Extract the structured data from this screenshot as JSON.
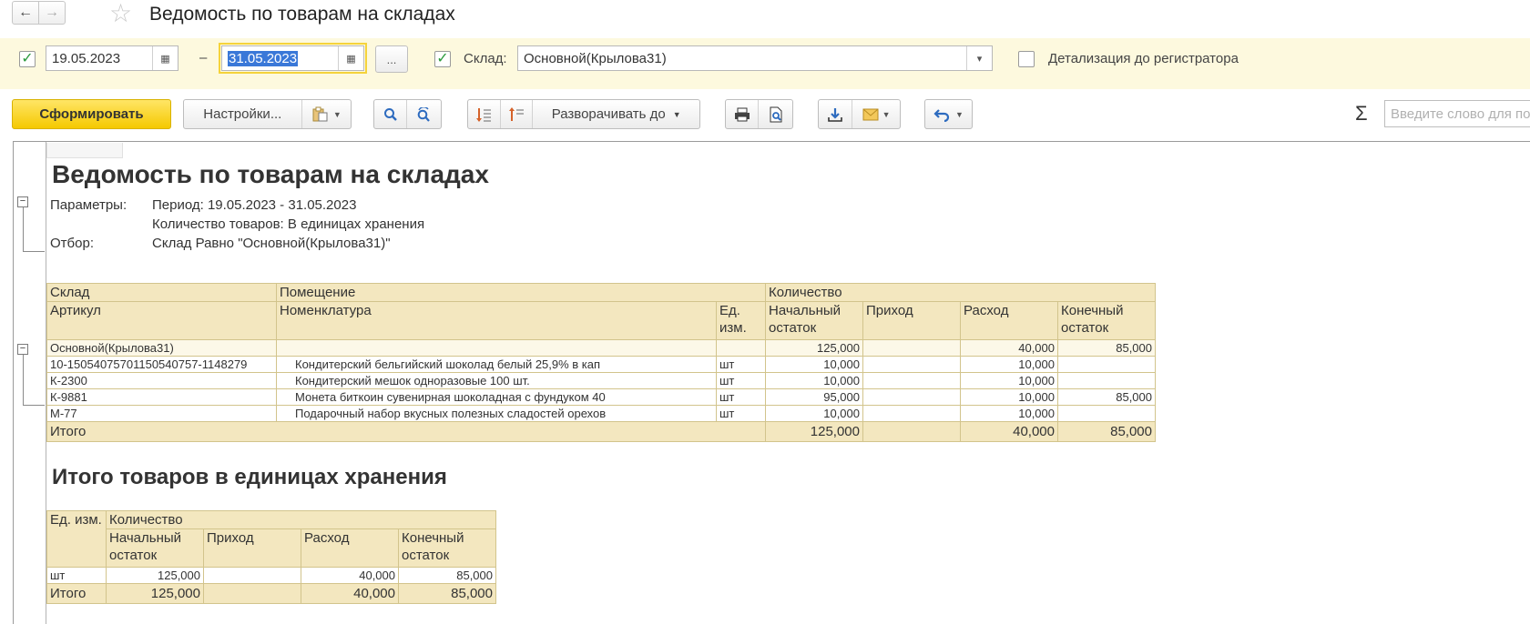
{
  "window": {
    "title": "Ведомость по товарам на складах",
    "back_icon": "←",
    "forward_icon": "→",
    "star_icon": "☆"
  },
  "filters": {
    "period_enabled": "✓",
    "date_from": "19.05.2023",
    "date_separator": "–",
    "date_to": "31.05.2023",
    "period_button": "...",
    "warehouse_enabled": "✓",
    "warehouse_label": "Склад:",
    "warehouse_value": "Основной(Крылова31)",
    "detail_label": "Детализация до регистратора",
    "calendar_icon": "▦",
    "dropdown_icon": "▾"
  },
  "toolbar": {
    "generate": "Сформировать",
    "settings": "Настройки...",
    "expand_to": "Разворачивать до",
    "sigma": "Σ",
    "search_placeholder": "Введите слово для поиска"
  },
  "report": {
    "title": "Ведомость по товарам на складах",
    "params_label": "Параметры:",
    "params_period": "Период: 19.05.2023 - 31.05.2023",
    "params_qty": "Количество товаров: В единицах хранения",
    "filter_label": "Отбор:",
    "filter_value": "Склад Равно \"Основной(Крылова31)\"",
    "main_table": {
      "h_sklad": "Склад",
      "h_pomeshchenie": "Помещение",
      "h_kolichestvo": "Количество",
      "h_artikul": "Артикул",
      "h_nomenklatura": "Номенклатура",
      "h_ed": "Ед. изм.",
      "h_nach": "Начальный остаток",
      "h_prihod": "Приход",
      "h_rashod": "Расход",
      "h_kon": "Конечный остаток",
      "group": {
        "name": "Основной(Крылова31)",
        "nach": "125,000",
        "prihod": "",
        "rashod": "40,000",
        "kon": "85,000"
      },
      "rows": [
        {
          "artikul": "10-15054075701150540757-1148279",
          "name": "Кондитерский бельгийский шоколад белый 25,9% в кап",
          "ed": "шт",
          "nach": "10,000",
          "prihod": "",
          "rashod": "10,000",
          "kon": ""
        },
        {
          "artikul": "К-2300",
          "name": "Кондитерский мешок одноразовые 100 шт.",
          "ed": "шт",
          "nach": "10,000",
          "prihod": "",
          "rashod": "10,000",
          "kon": ""
        },
        {
          "artikul": "К-9881",
          "name": "Монета биткоин сувенирная шоколадная с фундуком 40",
          "ed": "шт",
          "nach": "95,000",
          "prihod": "",
          "rashod": "10,000",
          "kon": "85,000"
        },
        {
          "artikul": "М-77",
          "name": "Подарочный набор вкусных полезных сладостей орехов",
          "ed": "шт",
          "nach": "10,000",
          "prihod": "",
          "rashod": "10,000",
          "kon": ""
        }
      ],
      "total": {
        "label": "Итого",
        "nach": "125,000",
        "prihod": "",
        "rashod": "40,000",
        "kon": "85,000"
      }
    },
    "subtitle": "Итого товаров в единицах хранения",
    "sum_table": {
      "h_ed": "Ед. изм.",
      "h_kolichestvo": "Количество",
      "h_nach": "Начальный остаток",
      "h_prihod": "Приход",
      "h_rashod": "Расход",
      "h_kon": "Конечный остаток",
      "row": {
        "ed": "шт",
        "nach": "125,000",
        "prihod": "",
        "rashod": "40,000",
        "kon": "85,000"
      },
      "total": {
        "label": "Итого",
        "nach": "125,000",
        "prihod": "",
        "rashod": "40,000",
        "kon": "85,000"
      }
    }
  }
}
